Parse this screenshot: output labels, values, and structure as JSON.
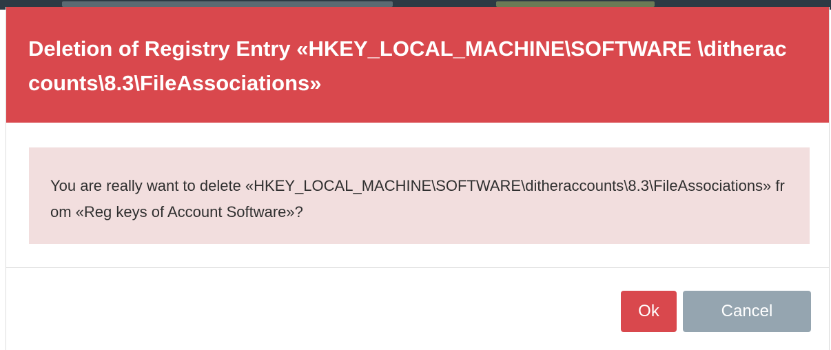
{
  "dialog": {
    "title": "Deletion of Registry Entry «HKEY_LOCAL_MACHINE\\SOFTWARE \\ditheraccounts\\8.3\\FileAssociations»",
    "message": "You are really want to delete «HKEY_LOCAL_MACHINE\\SOFTWARE\\ditheraccounts\\8.3\\FileAssociations» from «Reg keys of Account Software»?",
    "ok_label": "Ok",
    "cancel_label": "Cancel"
  },
  "colors": {
    "header_bg": "#d9484d",
    "alert_bg": "#f2dede",
    "ok_bg": "#d9484d",
    "cancel_bg": "#95a5b0"
  }
}
